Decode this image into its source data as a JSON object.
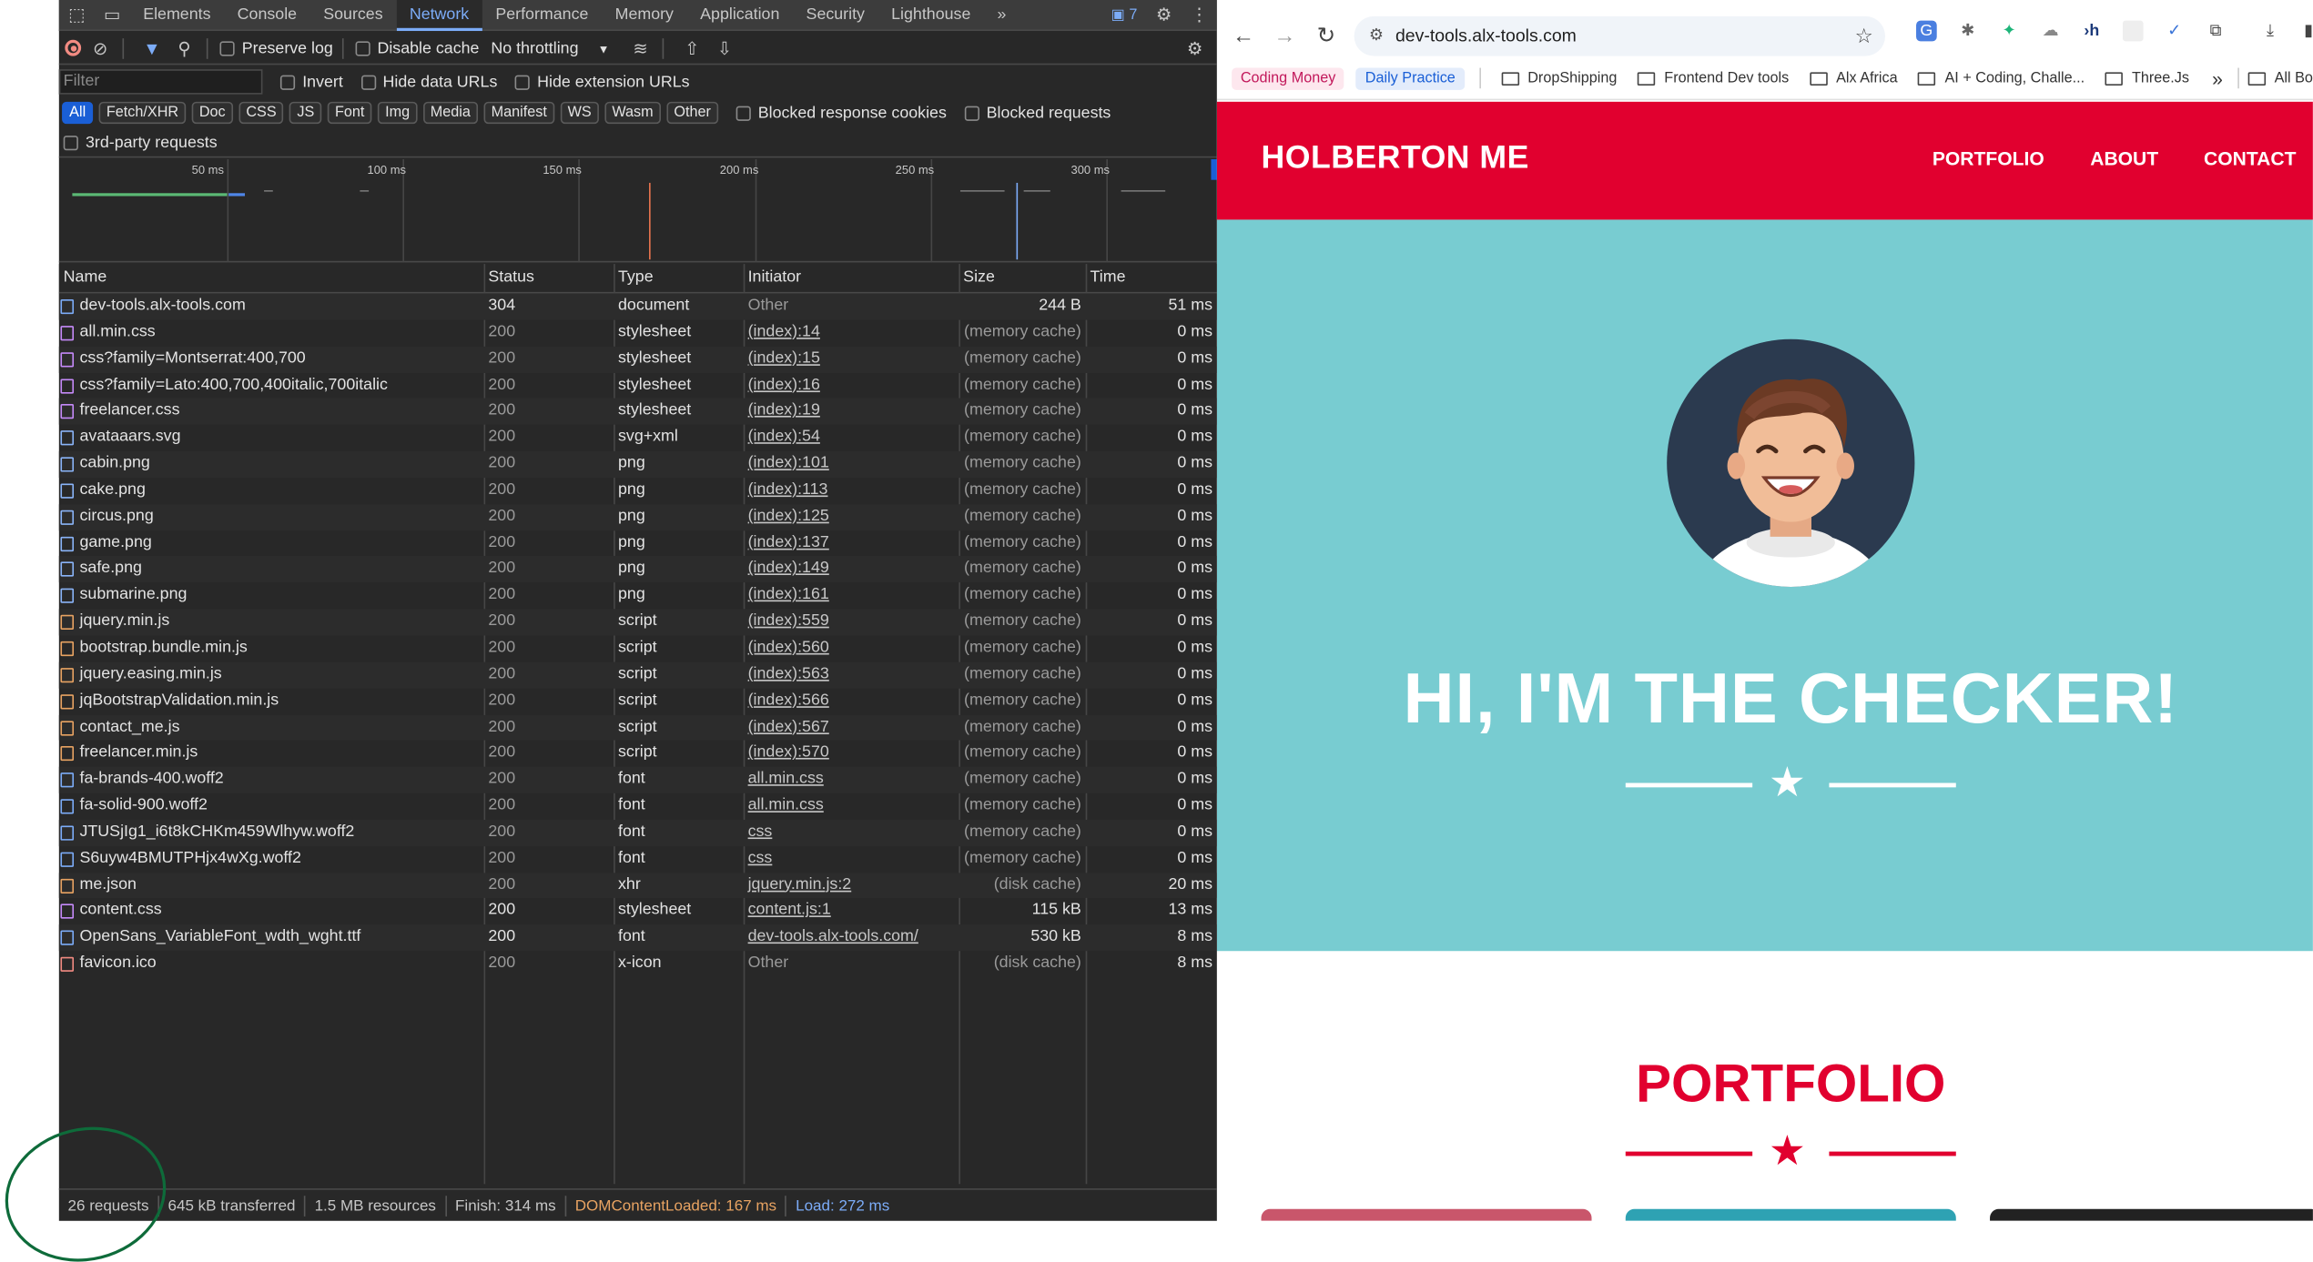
{
  "devtools": {
    "tabs": [
      "Elements",
      "Console",
      "Sources",
      "Network",
      "Performance",
      "Memory",
      "Application",
      "Security",
      "Lighthouse"
    ],
    "more_tabs": "»",
    "issues_badge": "7",
    "toolbar": {
      "preserve_log": "Preserve log",
      "disable_cache": "Disable cache",
      "throttling": "No throttling"
    },
    "filter_placeholder": "Filter",
    "invert": "Invert",
    "hide_data_urls": "Hide data URLs",
    "hide_extension_urls": "Hide extension URLs",
    "type_filters": [
      "All",
      "Fetch/XHR",
      "Doc",
      "CSS",
      "JS",
      "Font",
      "Img",
      "Media",
      "Manifest",
      "WS",
      "Wasm",
      "Other"
    ],
    "blocked_response_cookies": "Blocked response cookies",
    "blocked_requests": "Blocked requests",
    "third_party": "3rd-party requests",
    "timeline_ticks": [
      "50 ms",
      "100 ms",
      "150 ms",
      "200 ms",
      "250 ms",
      "300 ms"
    ],
    "columns": [
      "Name",
      "Status",
      "Type",
      "Initiator",
      "Size",
      "Time"
    ],
    "requests": [
      {
        "name": "dev-tools.alx-tools.com",
        "status": "304",
        "type": "document",
        "initiator": "Other",
        "size": "244 B",
        "time": "51 ms",
        "kind": "doc"
      },
      {
        "name": "all.min.css",
        "status": "200",
        "type": "stylesheet",
        "initiator": "(index):14",
        "size": "(memory cache)",
        "time": "0 ms",
        "kind": "css"
      },
      {
        "name": "css?family=Montserrat:400,700",
        "status": "200",
        "type": "stylesheet",
        "initiator": "(index):15",
        "size": "(memory cache)",
        "time": "0 ms",
        "kind": "css"
      },
      {
        "name": "css?family=Lato:400,700,400italic,700italic",
        "status": "200",
        "type": "stylesheet",
        "initiator": "(index):16",
        "size": "(memory cache)",
        "time": "0 ms",
        "kind": "css"
      },
      {
        "name": "freelancer.css",
        "status": "200",
        "type": "stylesheet",
        "initiator": "(index):19",
        "size": "(memory cache)",
        "time": "0 ms",
        "kind": "css"
      },
      {
        "name": "avataaars.svg",
        "status": "200",
        "type": "svg+xml",
        "initiator": "(index):54",
        "size": "(memory cache)",
        "time": "0 ms",
        "kind": "img"
      },
      {
        "name": "cabin.png",
        "status": "200",
        "type": "png",
        "initiator": "(index):101",
        "size": "(memory cache)",
        "time": "0 ms",
        "kind": "img"
      },
      {
        "name": "cake.png",
        "status": "200",
        "type": "png",
        "initiator": "(index):113",
        "size": "(memory cache)",
        "time": "0 ms",
        "kind": "img"
      },
      {
        "name": "circus.png",
        "status": "200",
        "type": "png",
        "initiator": "(index):125",
        "size": "(memory cache)",
        "time": "0 ms",
        "kind": "img"
      },
      {
        "name": "game.png",
        "status": "200",
        "type": "png",
        "initiator": "(index):137",
        "size": "(memory cache)",
        "time": "0 ms",
        "kind": "img"
      },
      {
        "name": "safe.png",
        "status": "200",
        "type": "png",
        "initiator": "(index):149",
        "size": "(memory cache)",
        "time": "0 ms",
        "kind": "img"
      },
      {
        "name": "submarine.png",
        "status": "200",
        "type": "png",
        "initiator": "(index):161",
        "size": "(memory cache)",
        "time": "0 ms",
        "kind": "img"
      },
      {
        "name": "jquery.min.js",
        "status": "200",
        "type": "script",
        "initiator": "(index):559",
        "size": "(memory cache)",
        "time": "0 ms",
        "kind": "js"
      },
      {
        "name": "bootstrap.bundle.min.js",
        "status": "200",
        "type": "script",
        "initiator": "(index):560",
        "size": "(memory cache)",
        "time": "0 ms",
        "kind": "js"
      },
      {
        "name": "jquery.easing.min.js",
        "status": "200",
        "type": "script",
        "initiator": "(index):563",
        "size": "(memory cache)",
        "time": "0 ms",
        "kind": "js"
      },
      {
        "name": "jqBootstrapValidation.min.js",
        "status": "200",
        "type": "script",
        "initiator": "(index):566",
        "size": "(memory cache)",
        "time": "0 ms",
        "kind": "js"
      },
      {
        "name": "contact_me.js",
        "status": "200",
        "type": "script",
        "initiator": "(index):567",
        "size": "(memory cache)",
        "time": "0 ms",
        "kind": "js"
      },
      {
        "name": "freelancer.min.js",
        "status": "200",
        "type": "script",
        "initiator": "(index):570",
        "size": "(memory cache)",
        "time": "0 ms",
        "kind": "js"
      },
      {
        "name": "fa-brands-400.woff2",
        "status": "200",
        "type": "font",
        "initiator": "all.min.css",
        "size": "(memory cache)",
        "time": "0 ms",
        "kind": "font"
      },
      {
        "name": "fa-solid-900.woff2",
        "status": "200",
        "type": "font",
        "initiator": "all.min.css",
        "size": "(memory cache)",
        "time": "0 ms",
        "kind": "font"
      },
      {
        "name": "JTUSjIg1_i6t8kCHKm459Wlhyw.woff2",
        "status": "200",
        "type": "font",
        "initiator": "css",
        "size": "(memory cache)",
        "time": "0 ms",
        "kind": "font"
      },
      {
        "name": "S6uyw4BMUTPHjx4wXg.woff2",
        "status": "200",
        "type": "font",
        "initiator": "css",
        "size": "(memory cache)",
        "time": "0 ms",
        "kind": "font"
      },
      {
        "name": "me.json",
        "status": "200",
        "type": "xhr",
        "initiator": "jquery.min.js:2",
        "size": "(disk cache)",
        "time": "20 ms",
        "kind": "xhr"
      },
      {
        "name": "content.css",
        "status": "200",
        "type": "stylesheet",
        "initiator": "content.js:1",
        "size": "115 kB",
        "time": "13 ms",
        "kind": "css"
      },
      {
        "name": "OpenSans_VariableFont_wdth_wght.ttf",
        "status": "200",
        "type": "font",
        "initiator": "dev-tools.alx-tools.com/",
        "size": "530 kB",
        "time": "8 ms",
        "kind": "font"
      },
      {
        "name": "favicon.ico",
        "status": "200",
        "type": "x-icon",
        "initiator": "Other",
        "size": "(disk cache)",
        "time": "8 ms",
        "kind": "ico"
      }
    ],
    "summary": {
      "requests": "26 requests",
      "transferred": "645 kB transferred",
      "resources": "1.5 MB resources",
      "finish": "Finish: 314 ms",
      "dom_content_loaded": "DOMContentLoaded: 167 ms",
      "load": "Load: 272 ms"
    }
  },
  "browser": {
    "url": "dev-tools.alx-tools.com",
    "bookmarks": {
      "pill_1": "Coding Money",
      "pill_2": "Daily Practice",
      "folders": [
        "DropShipping",
        "Frontend Dev tools",
        "Alx Africa",
        "AI + Coding, Challe...",
        "Three.Js"
      ],
      "overflow": "»",
      "all": "All Bo"
    },
    "site": {
      "brand": "HOLBERTON ME",
      "nav": [
        "PORTFOLIO",
        "ABOUT",
        "CONTACT"
      ],
      "hero_title": "HI, I'M THE CHECKER!",
      "portfolio_title": "PORTFOLIO"
    }
  },
  "colors": {
    "site_red": "#e1002f",
    "hero_teal": "#78ccd1",
    "devtools_bg": "#282828",
    "devtools_accent": "#7cacf8",
    "annotation_green": "#0e6b3a"
  }
}
